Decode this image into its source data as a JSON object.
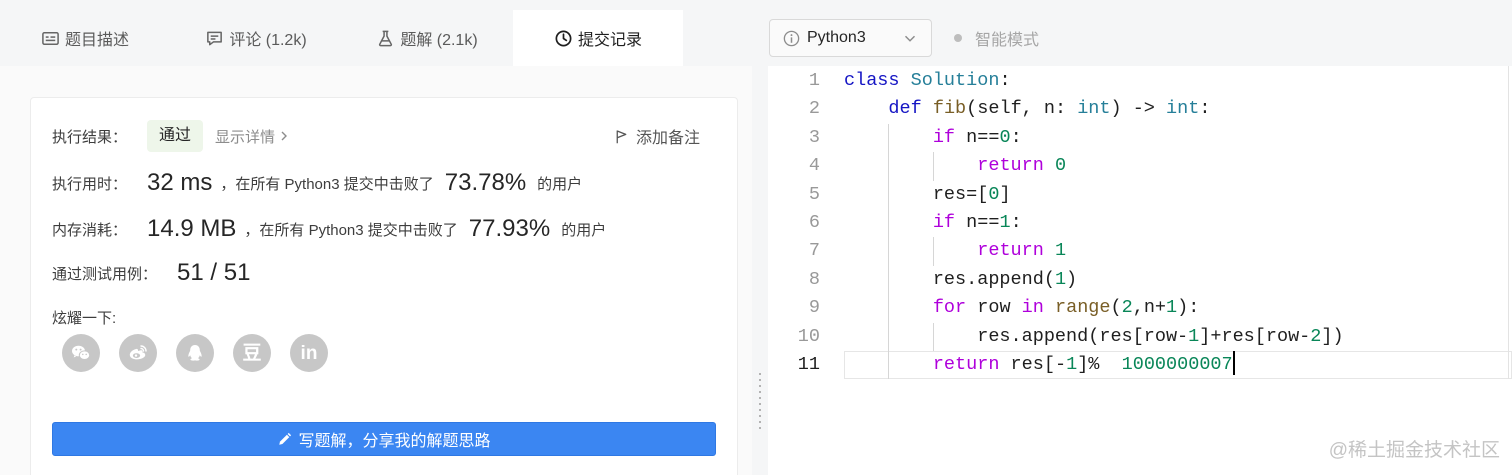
{
  "tabs": [
    {
      "label": "题目描述",
      "icon": "description-icon",
      "active": false
    },
    {
      "label": "评论 (1.2k)",
      "icon": "comment-icon",
      "active": false
    },
    {
      "label": "题解 (2.1k)",
      "icon": "flask-icon",
      "active": false
    },
    {
      "label": "提交记录",
      "icon": "clock-icon",
      "active": true
    }
  ],
  "submission": {
    "result_label": "执行结果：",
    "result_status": "通过",
    "details_link": "显示详情",
    "add_note": "添加备注",
    "runtime": {
      "label": "执行用时：",
      "value": "32 ms",
      "middle": "，在所有 Python3 提交中击败了",
      "percent": "73.78%",
      "suffix": "的用户"
    },
    "memory": {
      "label": "内存消耗：",
      "value": "14.9 MB",
      "middle": "，在所有 Python3 提交中击败了",
      "percent": "77.93%",
      "suffix": "的用户"
    },
    "testcases": {
      "label": "通过测试用例：",
      "value": "51 / 51"
    },
    "share": {
      "label": "炫耀一下:",
      "icons": [
        "wechat-icon",
        "weibo-icon",
        "qq-icon",
        "douban-icon",
        "linkedin-icon"
      ],
      "douban_glyph": "豆",
      "linkedin_glyph": "in"
    },
    "write_solution": "写题解，分享我的解题思路"
  },
  "editor": {
    "language": "Python3",
    "mode": "智能模式",
    "active_line": 11,
    "lines": [
      {
        "n": 1,
        "tokens": [
          [
            "class",
            "#1515c4"
          ],
          [
            " "
          ],
          [
            "Solution",
            "#267f99"
          ],
          [
            ":"
          ]
        ]
      },
      {
        "n": 2,
        "tokens": [
          [
            "    "
          ],
          [
            "def",
            "#1515c4"
          ],
          [
            " "
          ],
          [
            "fib",
            "#795e26"
          ],
          [
            "(self, n: "
          ],
          [
            "int",
            "#267f99"
          ],
          [
            ") -> "
          ],
          [
            "int",
            "#267f99"
          ],
          [
            ":"
          ]
        ]
      },
      {
        "n": 3,
        "tokens": [
          [
            "        "
          ],
          [
            "if",
            "#af00db"
          ],
          [
            " n=="
          ],
          [
            "0",
            "#098658"
          ],
          [
            ":"
          ]
        ]
      },
      {
        "n": 4,
        "tokens": [
          [
            "            "
          ],
          [
            "return",
            "#af00db"
          ],
          [
            " "
          ],
          [
            "0",
            "#098658"
          ]
        ]
      },
      {
        "n": 5,
        "tokens": [
          [
            "        res=["
          ],
          [
            "0",
            "#098658"
          ],
          [
            "]"
          ]
        ]
      },
      {
        "n": 6,
        "tokens": [
          [
            "        "
          ],
          [
            "if",
            "#af00db"
          ],
          [
            " n=="
          ],
          [
            "1",
            "#098658"
          ],
          [
            ":"
          ]
        ]
      },
      {
        "n": 7,
        "tokens": [
          [
            "            "
          ],
          [
            "return",
            "#af00db"
          ],
          [
            " "
          ],
          [
            "1",
            "#098658"
          ]
        ]
      },
      {
        "n": 8,
        "tokens": [
          [
            "        res.append("
          ],
          [
            "1",
            "#098658"
          ],
          [
            ")"
          ]
        ]
      },
      {
        "n": 9,
        "tokens": [
          [
            "        "
          ],
          [
            "for",
            "#af00db"
          ],
          [
            " row "
          ],
          [
            "in",
            "#af00db"
          ],
          [
            " "
          ],
          [
            "range",
            "#795e26"
          ],
          [
            "("
          ],
          [
            "2",
            "#098658"
          ],
          [
            ",n+"
          ],
          [
            "1",
            "#098658"
          ],
          [
            "):"
          ]
        ]
      },
      {
        "n": 10,
        "tokens": [
          [
            "            res.append(res[row-"
          ],
          [
            "1",
            "#098658"
          ],
          [
            "]+res[row-"
          ],
          [
            "2",
            "#098658"
          ],
          [
            "])"
          ]
        ]
      },
      {
        "n": 11,
        "tokens": [
          [
            "        "
          ],
          [
            "return",
            "#af00db"
          ],
          [
            " res[-"
          ],
          [
            "1",
            "#098658"
          ],
          [
            "]%  "
          ],
          [
            "1000000007",
            "#098658"
          ]
        ]
      }
    ]
  },
  "watermark": "@稀土掘金技术社区",
  "colors": {
    "accent": "#3b86f2",
    "pass_badge_bg": "#eef6ea",
    "panel_bg": "#f5f6f7",
    "social_icon_bg": "#c7c7c7"
  }
}
